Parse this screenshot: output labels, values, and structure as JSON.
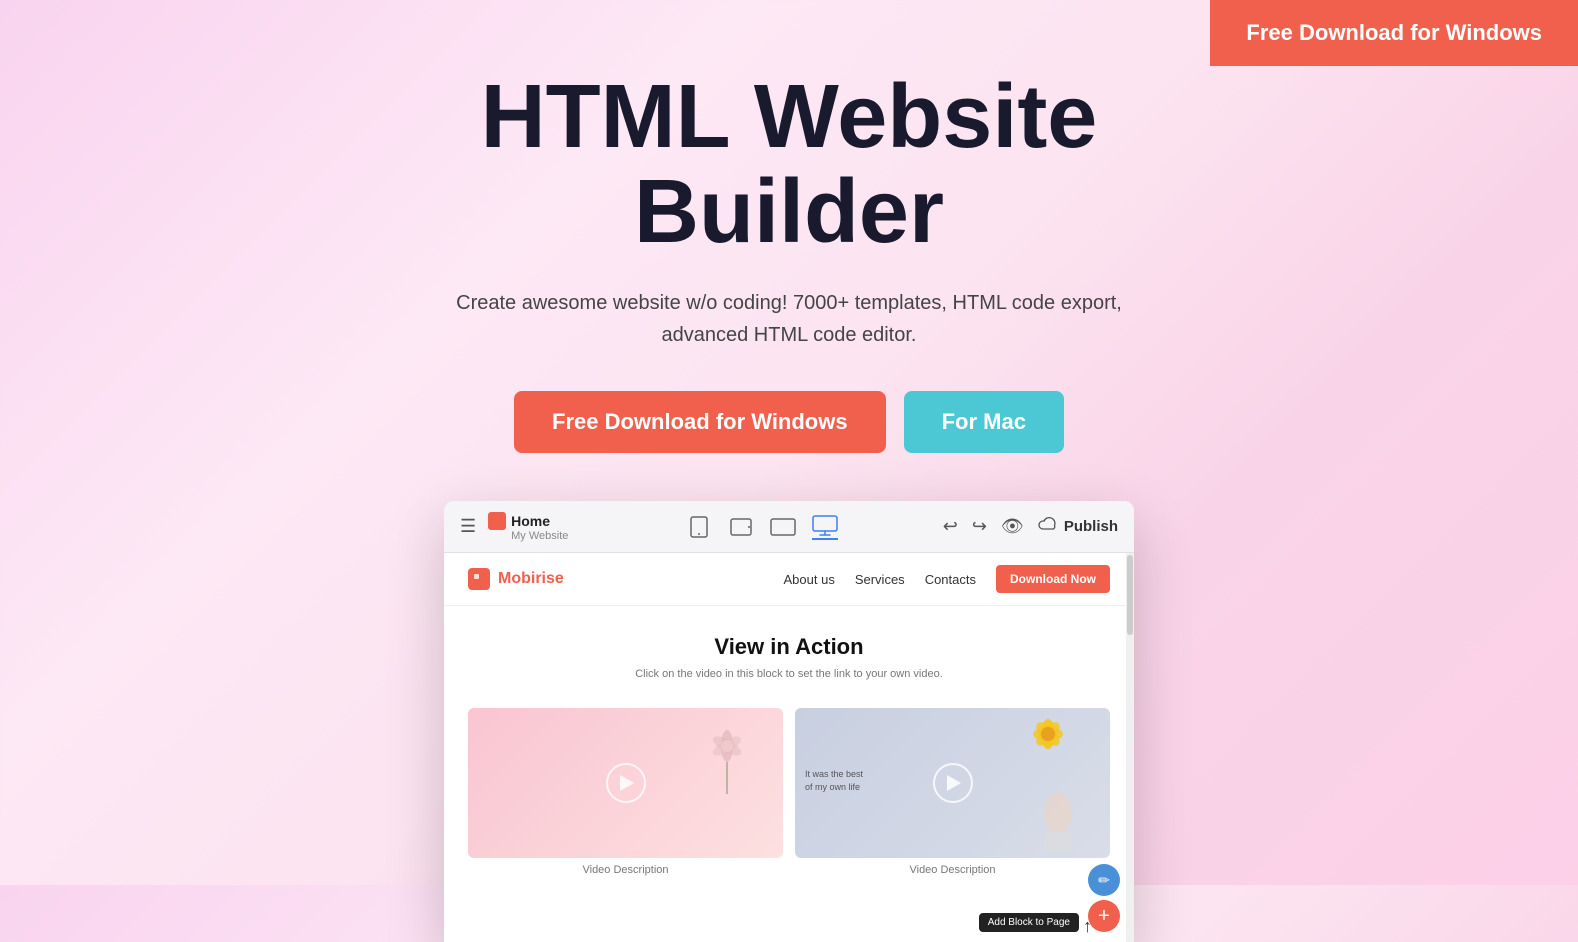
{
  "topCta": {
    "label": "Free Download for Windows"
  },
  "hero": {
    "title_line1": "HTML Website",
    "title_line2": "Builder",
    "subtitle": "Create awesome website w/o coding! 7000+ templates, HTML code export, advanced HTML code editor.",
    "btn_windows": "Free Download for Windows",
    "btn_mac": "For Mac"
  },
  "appPreview": {
    "toolbar": {
      "menuIcon": "☰",
      "pageIcon": "🏠",
      "pageName": "Home",
      "siteName": "My Website",
      "deviceMobile": "📱",
      "deviceTabletSmall": "▭",
      "deviceTablet": "▬",
      "deviceDesktop": "🖥",
      "undoIcon": "↩",
      "redoIcon": "↪",
      "previewIcon": "👁",
      "cloudIcon": "☁",
      "publishLabel": "Publish"
    },
    "sitePreview": {
      "logoName": "Mobirise",
      "navLinks": [
        "About us",
        "Services",
        "Contacts"
      ],
      "navCta": "Download Now",
      "heroTitle": "View in Action",
      "heroSubtitle": "Click on the video in this block to set the link to your own video.",
      "video1Desc": "Video Description",
      "video2Desc": "Video Description",
      "addBlockLabel": "Add Block to Page",
      "fabEditIcon": "✏",
      "fabAddIcon": "+"
    }
  }
}
